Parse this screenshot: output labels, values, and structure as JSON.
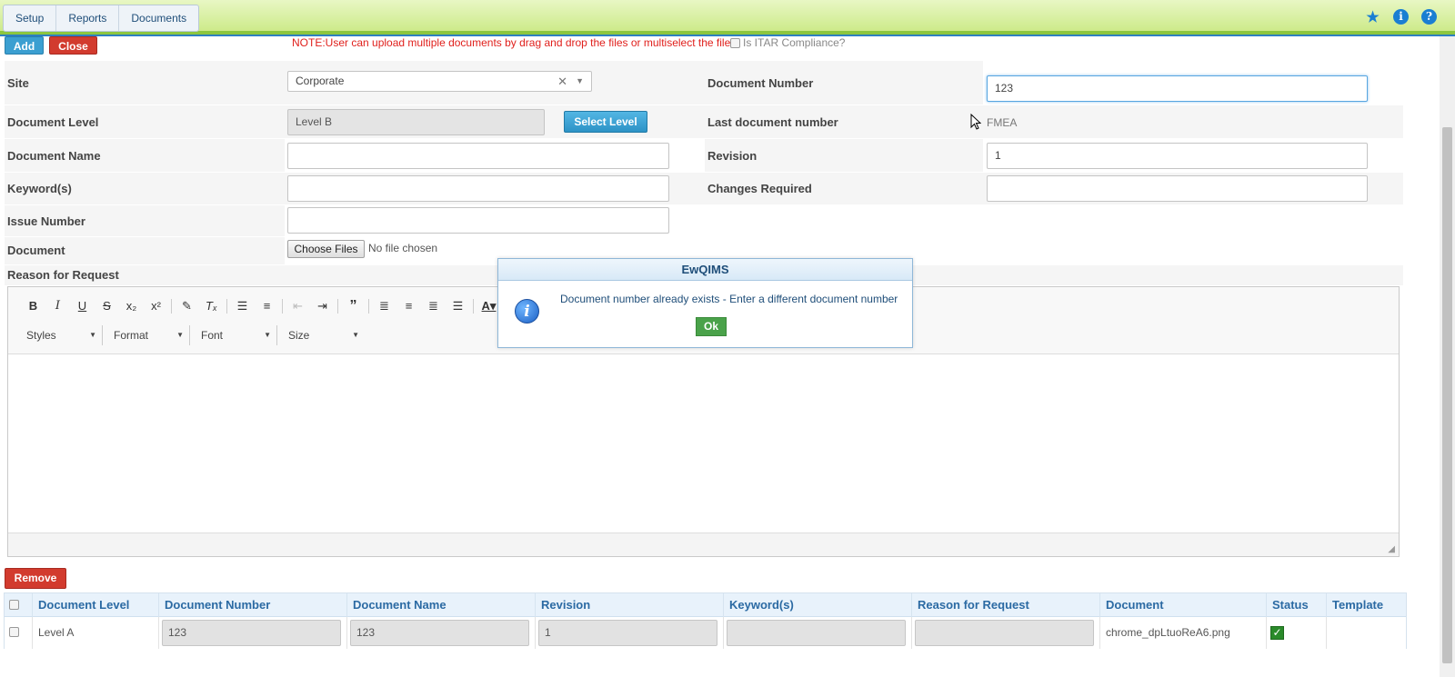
{
  "topbar": {
    "tabs": [
      "Setup",
      "Reports",
      "Documents"
    ],
    "icons": [
      "pin-icon",
      "info-icon",
      "help-icon"
    ]
  },
  "actions": {
    "add_label": "Add",
    "close_label": "Close",
    "note": "NOTE:User can upload multiple documents by drag and drop the files or multiselect the files",
    "itar_label": "Is ITAR Compliance?"
  },
  "form": {
    "site_label": "Site",
    "site_value": "Corporate",
    "doc_number_label": "Document Number",
    "doc_number_value": "123",
    "doc_level_label": "Document Level",
    "doc_level_value": "Level B",
    "select_level_label": "Select Level",
    "last_doc_number_label": "Last document number",
    "last_doc_number_value": "FMEA",
    "doc_name_label": "Document Name",
    "doc_name_value": "",
    "revision_label": "Revision",
    "revision_value": "1",
    "keywords_label": "Keyword(s)",
    "keywords_value": "",
    "changes_label": "Changes Required",
    "changes_value": "",
    "issue_label": "Issue Number",
    "issue_value": "",
    "document_label": "Document",
    "choose_files_label": "Choose Files",
    "no_file_text": "No file chosen",
    "reason_label": "Reason for Request"
  },
  "editor": {
    "combos": [
      "Styles",
      "Format",
      "Font",
      "Size"
    ]
  },
  "dialog": {
    "title": "EwQIMS",
    "message": "Document number already exists - Enter a different document number",
    "ok_label": "Ok"
  },
  "grid": {
    "remove_label": "Remove",
    "columns": [
      "Document Level",
      "Document Number",
      "Document Name",
      "Revision",
      "Keyword(s)",
      "Reason for Request",
      "Document",
      "Status",
      "Template"
    ],
    "rows": [
      {
        "level": "Level A",
        "number": "123",
        "name": "123",
        "revision": "1",
        "keywords": "",
        "reason": "",
        "document": "chrome_dpLtuoReA6.png",
        "status": true,
        "template": ""
      }
    ]
  }
}
